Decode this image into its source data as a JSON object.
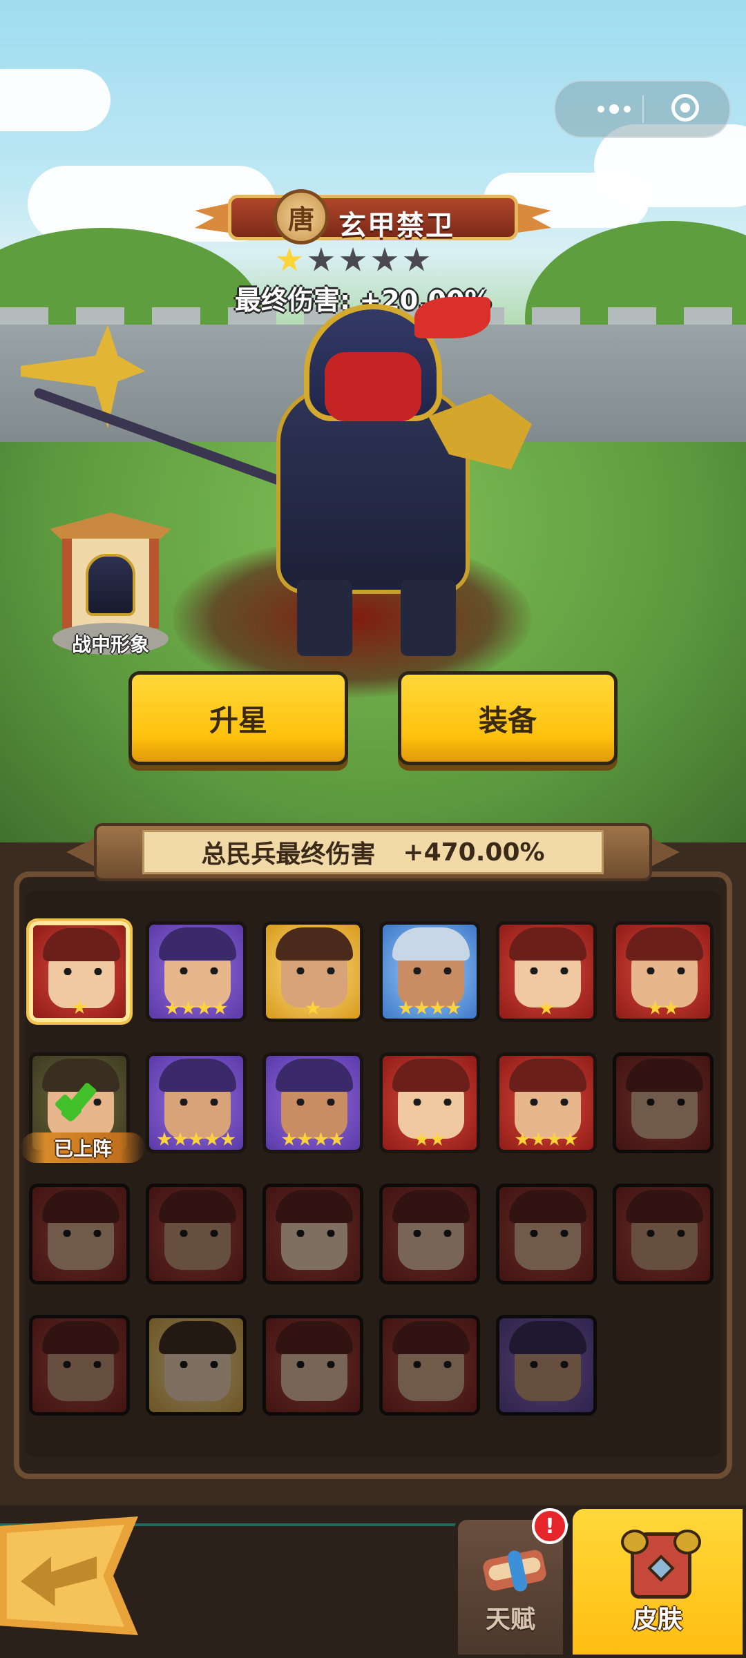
{
  "hero": {
    "faction": "唐",
    "name": "玄甲禁卫",
    "stars_total": 5,
    "stars_filled": 1,
    "final_damage_text": "最终伤害: +20.00%"
  },
  "shrine": {
    "label": "战中形象"
  },
  "actions": {
    "star_up": "升星",
    "equip": "装备"
  },
  "summary": {
    "label": "总民兵最终伤害",
    "value": "+470.00%"
  },
  "roster": [
    [
      {
        "rarity": "red",
        "stars": 1,
        "selected": true
      },
      {
        "rarity": "purple",
        "stars": 4
      },
      {
        "rarity": "gold",
        "stars": 1
      },
      {
        "rarity": "blue",
        "stars": 4
      },
      {
        "rarity": "red",
        "stars": 1
      },
      {
        "rarity": "red",
        "stars": 2
      }
    ],
    [
      {
        "rarity": "olive",
        "stars": 0,
        "on_team": true
      },
      {
        "rarity": "purple",
        "stars": 5
      },
      {
        "rarity": "purple",
        "stars": 4
      },
      {
        "rarity": "red",
        "stars": 2
      },
      {
        "rarity": "red",
        "stars": 4
      },
      {
        "rarity": "red",
        "stars": 0,
        "locked": true
      }
    ],
    [
      {
        "rarity": "red",
        "stars": 0,
        "locked": true
      },
      {
        "rarity": "red",
        "stars": 0,
        "locked": true
      },
      {
        "rarity": "red",
        "stars": 0,
        "locked": true
      },
      {
        "rarity": "red",
        "stars": 0,
        "locked": true
      },
      {
        "rarity": "red",
        "stars": 0,
        "locked": true
      },
      {
        "rarity": "red",
        "stars": 0,
        "locked": true
      }
    ],
    [
      {
        "rarity": "red",
        "stars": 0,
        "locked": true
      },
      {
        "rarity": "gold",
        "stars": 0,
        "locked": true
      },
      {
        "rarity": "red",
        "stars": 0,
        "locked": true
      },
      {
        "rarity": "red",
        "stars": 0,
        "locked": true
      },
      {
        "rarity": "purple",
        "stars": 0,
        "locked": true
      }
    ]
  ],
  "on_team_label": "已上阵",
  "tabs": {
    "talent": "天赋",
    "skin": "皮肤",
    "talent_badge": "!"
  },
  "colors": {
    "accent_yellow": "#ffc20e",
    "panel_brown": "#3b2c22",
    "banner_red": "#b0462c"
  }
}
